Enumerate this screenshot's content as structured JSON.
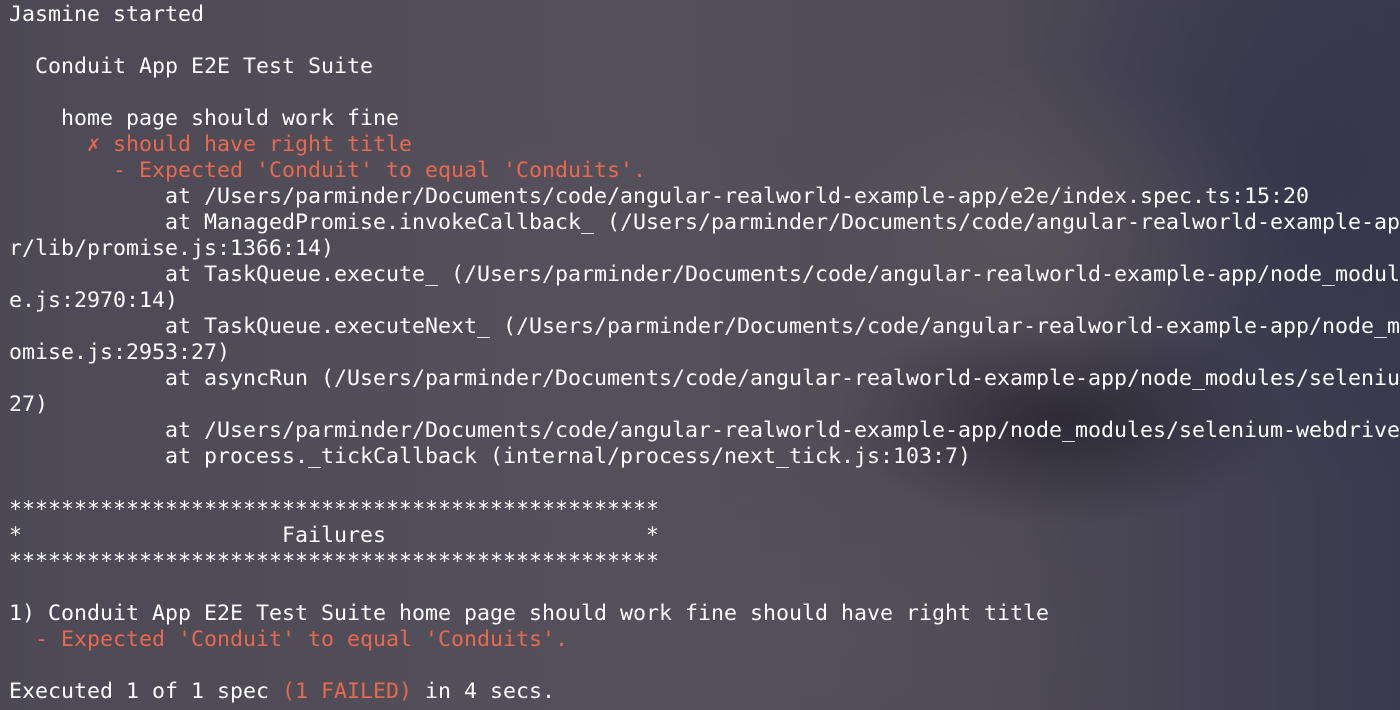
{
  "colors": {
    "text": "#ffffff",
    "error": "#e8694d"
  },
  "terminal": {
    "lines": [
      "Jasmine started",
      "",
      "  Conduit App E2E Test Suite",
      "",
      "    home page should work fine",
      "      ✗ should have right title",
      "        - Expected 'Conduit' to equal 'Conduits'.",
      "            at /Users/parminder/Documents/code/angular-realworld-example-app/e2e/index.spec.ts:15:20",
      "            at ManagedPromise.invokeCallback_ (/Users/parminder/Documents/code/angular-realworld-example-ap",
      "r/lib/promise.js:1366:14)",
      "            at TaskQueue.execute_ (/Users/parminder/Documents/code/angular-realworld-example-app/node_modul",
      "e.js:2970:14)",
      "            at TaskQueue.executeNext_ (/Users/parminder/Documents/code/angular-realworld-example-app/node_m",
      "omise.js:2953:27)",
      "            at asyncRun (/Users/parminder/Documents/code/angular-realworld-example-app/node_modules/seleniu",
      "27)",
      "            at /Users/parminder/Documents/code/angular-realworld-example-app/node_modules/selenium-webdrive",
      "            at process._tickCallback (internal/process/next_tick.js:103:7)",
      "",
      "**************************************************",
      "*                    Failures                    *",
      "**************************************************",
      "",
      "1) Conduit App E2E Test Suite home page should work fine should have right title",
      "  - Expected 'Conduit' to equal 'Conduits'.",
      "",
      "Executed 1 of 1 spec ",
      "(1 FAILED)",
      " in 4 secs."
    ]
  }
}
